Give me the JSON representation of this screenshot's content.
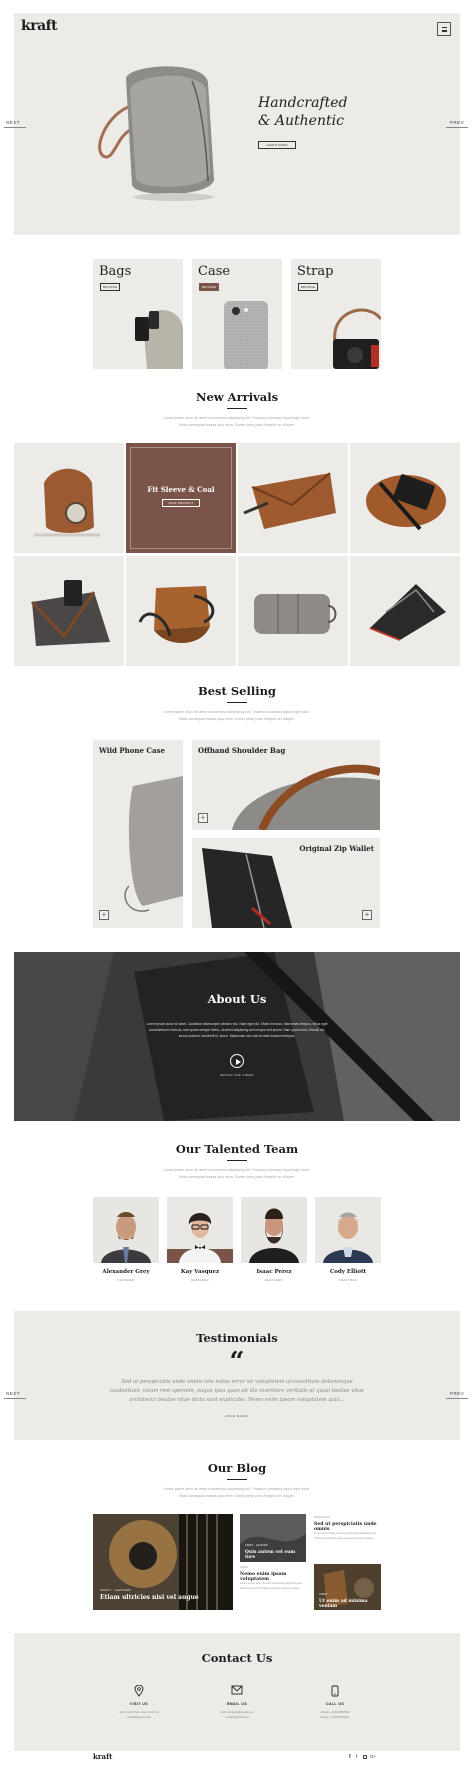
{
  "brand": {
    "logo": "kraft"
  },
  "hero": {
    "title_line1": "Handcrafted",
    "title_line2": "& Authentic",
    "button": "LEARN MORE",
    "next": "NEXT",
    "prev": "PREV"
  },
  "categories": [
    {
      "title": "Bags",
      "button": "BROWSE"
    },
    {
      "title": "Case",
      "button": "BROWSE"
    },
    {
      "title": "Strap",
      "button": "BROWSE"
    }
  ],
  "new_arrivals": {
    "title": "New Arrivals",
    "subtitle_line1": "Lorem ipsum dolor sit amet consectetur adipiscing elit. Vivamus commodo ligula eget dolor.",
    "subtitle_line2": "Nulla consequat massa quis enim. Donec pede justo fringilla vel aliquet.",
    "featured_title": "Fit Sleeve & Coal",
    "featured_button": "VIEW PRODUCT"
  },
  "best_selling": {
    "title": "Best Selling",
    "subtitle_line1": "Lorem ipsum dolor sit amet consectetur adipiscing elit. Vivamus commodo ligula eget dolor.",
    "subtitle_line2": "Nulla consequat massa quis enim. Donec pede justo fringilla vel aliquet.",
    "items": [
      "Wild Phone Case",
      "Offhand Shoulder Bag",
      "Original Zip Wallet"
    ]
  },
  "about": {
    "title": "About Us",
    "text_line1": "Lorem ipsum dolor sit amet. Curabitur ullamcorper ultricies nisi. Nam eget dui. Etiam rhoncus. Maecenas tempus, tellus eget",
    "text_line2": "condimentum rhoncus, sem quam semper libero, sit amet adipiscing sem neque sed ipsum. Nam quam nunc, blandit vel,",
    "text_line3": "luctus pulvinar, hendrerit id, lorem. Maecenas nec odio et ante tincidunt tempus.",
    "video_label": "WATCH THE VIDEO"
  },
  "team": {
    "title": "Our Talented Team",
    "subtitle_line1": "Lorem ipsum dolor sit amet consectetur adipiscing elit. Vivamus commodo ligula eget dolor.",
    "subtitle_line2": "Nulla consequat massa quis enim. Donec pede justo fringilla vel aliquet.",
    "members": [
      {
        "name": "Alexander Grey",
        "role": "FOUNDER"
      },
      {
        "name": "Kay Vasquez",
        "role": "DESIGNER"
      },
      {
        "name": "Isaac Perez",
        "role": "DESIGNER"
      },
      {
        "name": "Cody Elliott",
        "role": "CRAFTMAN"
      }
    ]
  },
  "testimonials": {
    "title": "Testimonials",
    "quote_line1": "Sed ut perspiciatis unde omnis iste natus error sit voluptatem accusantium doloremque",
    "quote_line2": "laudantium, totam rem aperiam, eaque ipsa quae ab illo inventore veritatis et quasi beatae vitae",
    "quote_line3": "architecto beatae vitae dicta sunt explicabo. Nemo enim ipsam voluptatem quia...",
    "author": "ANNA MARIA"
  },
  "blog": {
    "title": "Our Blog",
    "subtitle_line1": "Lorem ipsum dolor sit amet consectetur adipiscing elit. Vivamus commodo ligula eget dolor.",
    "subtitle_line2": "Nulla consequat massa quis enim. Donec pede justo fringilla vel aliquet.",
    "posts": [
      {
        "tag": "CRAFT · LEATHER",
        "title": "Etiam ultricies nisi vel augue"
      },
      {
        "tag": "CRAFT · LEATHER",
        "title": "Quis autem vel eum iure"
      },
      {
        "tag": "CRAFT",
        "title": "Nemo enim ipsam voluptatem"
      },
      {
        "tag": "WORKSHOP",
        "title": "Sed ut perspiciatis unde omnis"
      },
      {
        "tag": "CRAFT",
        "title": "Ut enim ad minima veniam"
      }
    ],
    "excerpt_line1": "Lorem ipsum dolor sit amet consectetur adipiscing elit.",
    "excerpt_line2": "Vivamus commodo ligula eget dolor aenean massa."
  },
  "contact": {
    "title": "Contact Us",
    "columns": [
      {
        "label": "VISIT US",
        "line1": "321 Lincoln Park, New York City",
        "line2": "US Washington DC"
      },
      {
        "label": "EMAIL US",
        "line1": "kraft.company@gmail.com",
        "line2": "contact@kraft.com"
      },
      {
        "label": "CALL US",
        "line1": "Mobile: +1(23)4567890",
        "line2": "Phone: +1(987)654321"
      }
    ]
  },
  "footer": {
    "logo": "kraft"
  },
  "colors": {
    "accent": "#7a5448",
    "panel": "#ecebe7",
    "dark": "#1e1e1e"
  }
}
